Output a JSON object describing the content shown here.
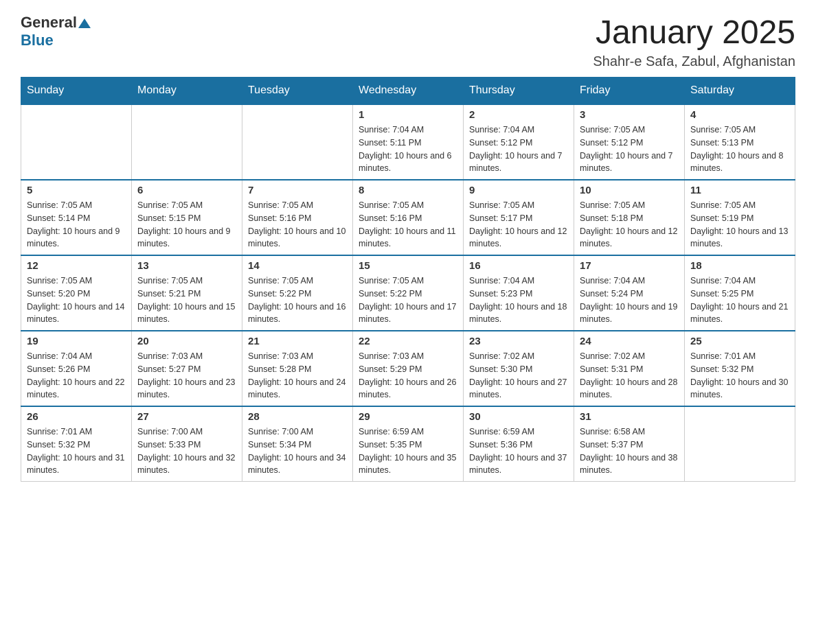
{
  "logo": {
    "text_general": "General",
    "text_blue": "Blue",
    "arrow": "▲"
  },
  "title": "January 2025",
  "subtitle": "Shahr-e Safa, Zabul, Afghanistan",
  "headers": [
    "Sunday",
    "Monday",
    "Tuesday",
    "Wednesday",
    "Thursday",
    "Friday",
    "Saturday"
  ],
  "weeks": [
    [
      {
        "day": "",
        "info": ""
      },
      {
        "day": "",
        "info": ""
      },
      {
        "day": "",
        "info": ""
      },
      {
        "day": "1",
        "info": "Sunrise: 7:04 AM\nSunset: 5:11 PM\nDaylight: 10 hours and 6 minutes."
      },
      {
        "day": "2",
        "info": "Sunrise: 7:04 AM\nSunset: 5:12 PM\nDaylight: 10 hours and 7 minutes."
      },
      {
        "day": "3",
        "info": "Sunrise: 7:05 AM\nSunset: 5:12 PM\nDaylight: 10 hours and 7 minutes."
      },
      {
        "day": "4",
        "info": "Sunrise: 7:05 AM\nSunset: 5:13 PM\nDaylight: 10 hours and 8 minutes."
      }
    ],
    [
      {
        "day": "5",
        "info": "Sunrise: 7:05 AM\nSunset: 5:14 PM\nDaylight: 10 hours and 9 minutes."
      },
      {
        "day": "6",
        "info": "Sunrise: 7:05 AM\nSunset: 5:15 PM\nDaylight: 10 hours and 9 minutes."
      },
      {
        "day": "7",
        "info": "Sunrise: 7:05 AM\nSunset: 5:16 PM\nDaylight: 10 hours and 10 minutes."
      },
      {
        "day": "8",
        "info": "Sunrise: 7:05 AM\nSunset: 5:16 PM\nDaylight: 10 hours and 11 minutes."
      },
      {
        "day": "9",
        "info": "Sunrise: 7:05 AM\nSunset: 5:17 PM\nDaylight: 10 hours and 12 minutes."
      },
      {
        "day": "10",
        "info": "Sunrise: 7:05 AM\nSunset: 5:18 PM\nDaylight: 10 hours and 12 minutes."
      },
      {
        "day": "11",
        "info": "Sunrise: 7:05 AM\nSunset: 5:19 PM\nDaylight: 10 hours and 13 minutes."
      }
    ],
    [
      {
        "day": "12",
        "info": "Sunrise: 7:05 AM\nSunset: 5:20 PM\nDaylight: 10 hours and 14 minutes."
      },
      {
        "day": "13",
        "info": "Sunrise: 7:05 AM\nSunset: 5:21 PM\nDaylight: 10 hours and 15 minutes."
      },
      {
        "day": "14",
        "info": "Sunrise: 7:05 AM\nSunset: 5:22 PM\nDaylight: 10 hours and 16 minutes."
      },
      {
        "day": "15",
        "info": "Sunrise: 7:05 AM\nSunset: 5:22 PM\nDaylight: 10 hours and 17 minutes."
      },
      {
        "day": "16",
        "info": "Sunrise: 7:04 AM\nSunset: 5:23 PM\nDaylight: 10 hours and 18 minutes."
      },
      {
        "day": "17",
        "info": "Sunrise: 7:04 AM\nSunset: 5:24 PM\nDaylight: 10 hours and 19 minutes."
      },
      {
        "day": "18",
        "info": "Sunrise: 7:04 AM\nSunset: 5:25 PM\nDaylight: 10 hours and 21 minutes."
      }
    ],
    [
      {
        "day": "19",
        "info": "Sunrise: 7:04 AM\nSunset: 5:26 PM\nDaylight: 10 hours and 22 minutes."
      },
      {
        "day": "20",
        "info": "Sunrise: 7:03 AM\nSunset: 5:27 PM\nDaylight: 10 hours and 23 minutes."
      },
      {
        "day": "21",
        "info": "Sunrise: 7:03 AM\nSunset: 5:28 PM\nDaylight: 10 hours and 24 minutes."
      },
      {
        "day": "22",
        "info": "Sunrise: 7:03 AM\nSunset: 5:29 PM\nDaylight: 10 hours and 26 minutes."
      },
      {
        "day": "23",
        "info": "Sunrise: 7:02 AM\nSunset: 5:30 PM\nDaylight: 10 hours and 27 minutes."
      },
      {
        "day": "24",
        "info": "Sunrise: 7:02 AM\nSunset: 5:31 PM\nDaylight: 10 hours and 28 minutes."
      },
      {
        "day": "25",
        "info": "Sunrise: 7:01 AM\nSunset: 5:32 PM\nDaylight: 10 hours and 30 minutes."
      }
    ],
    [
      {
        "day": "26",
        "info": "Sunrise: 7:01 AM\nSunset: 5:32 PM\nDaylight: 10 hours and 31 minutes."
      },
      {
        "day": "27",
        "info": "Sunrise: 7:00 AM\nSunset: 5:33 PM\nDaylight: 10 hours and 32 minutes."
      },
      {
        "day": "28",
        "info": "Sunrise: 7:00 AM\nSunset: 5:34 PM\nDaylight: 10 hours and 34 minutes."
      },
      {
        "day": "29",
        "info": "Sunrise: 6:59 AM\nSunset: 5:35 PM\nDaylight: 10 hours and 35 minutes."
      },
      {
        "day": "30",
        "info": "Sunrise: 6:59 AM\nSunset: 5:36 PM\nDaylight: 10 hours and 37 minutes."
      },
      {
        "day": "31",
        "info": "Sunrise: 6:58 AM\nSunset: 5:37 PM\nDaylight: 10 hours and 38 minutes."
      },
      {
        "day": "",
        "info": ""
      }
    ]
  ]
}
